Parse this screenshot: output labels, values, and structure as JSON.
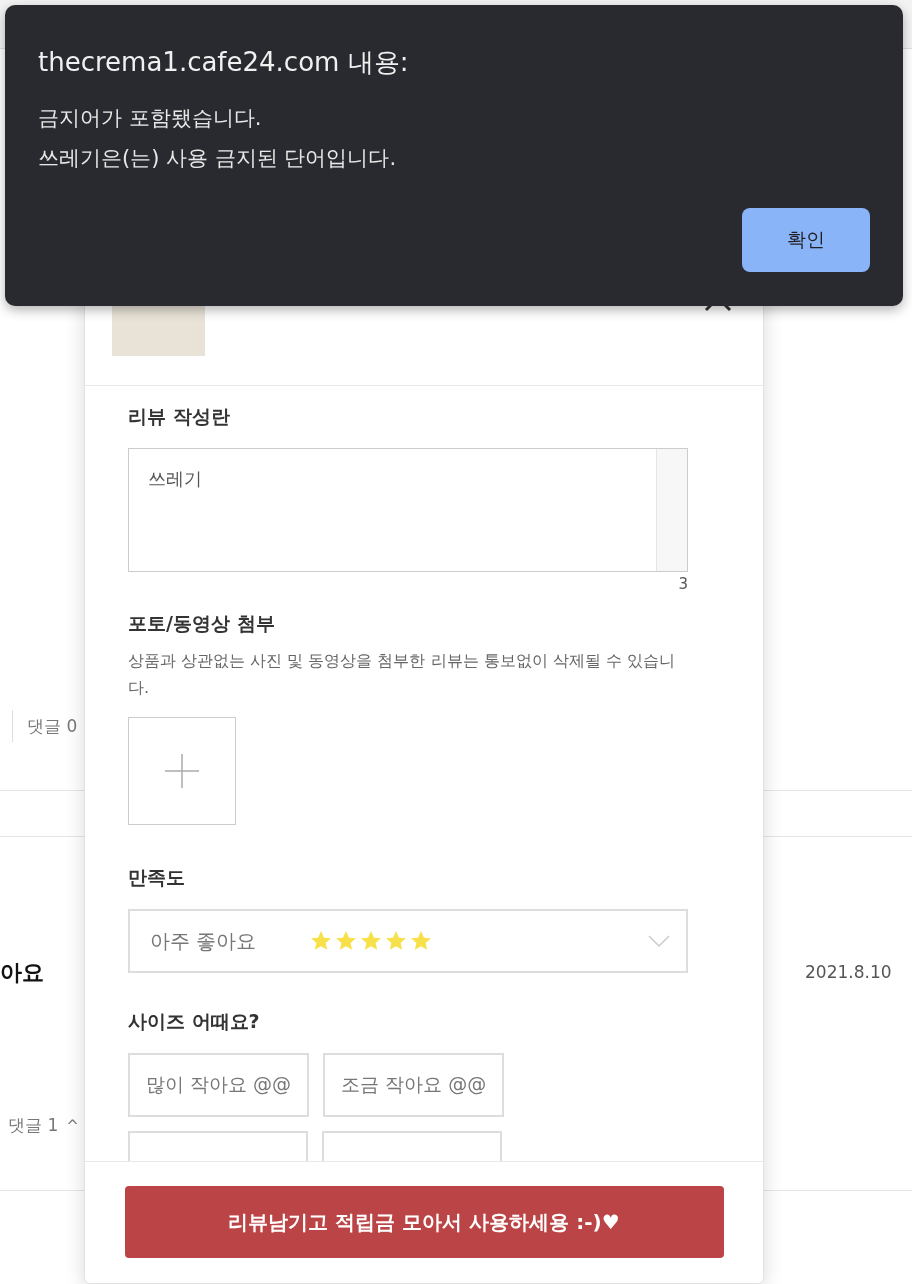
{
  "background_page": {
    "comment_count_1": "댓글 0",
    "review_title": "아요",
    "review_date": "2021.8.10",
    "comment_count_2": "댓글 1",
    "expand_caret": "^"
  },
  "review_modal": {
    "review_section": {
      "title": "리뷰 작성란",
      "value": "쓰레기",
      "char_count": "3"
    },
    "attach_section": {
      "title": "포토/동영상 첨부",
      "notice": "상품과 상관없는 사진 및 동영상을 첨부한 리뷰는 통보없이 삭제될 수 있습니다."
    },
    "satisfaction": {
      "title": "만족도",
      "value": "아주 좋아요",
      "stars": 5
    },
    "size": {
      "title": "사이즈 어때요?",
      "options": [
        {
          "label": "많이 작아요 @@",
          "selected": false
        },
        {
          "label": "조금 작아요 @@",
          "selected": false
        }
      ]
    },
    "submit_button": "리뷰남기고 적립금 모아서 사용하세용 :-)♥"
  },
  "alert": {
    "title": "thecrema1.cafe24.com 내용:",
    "lines": [
      "금지어가 포함됐습니다.",
      "쓰레기은(는) 사용 금지된 단어입니다."
    ],
    "button": "확인"
  }
}
